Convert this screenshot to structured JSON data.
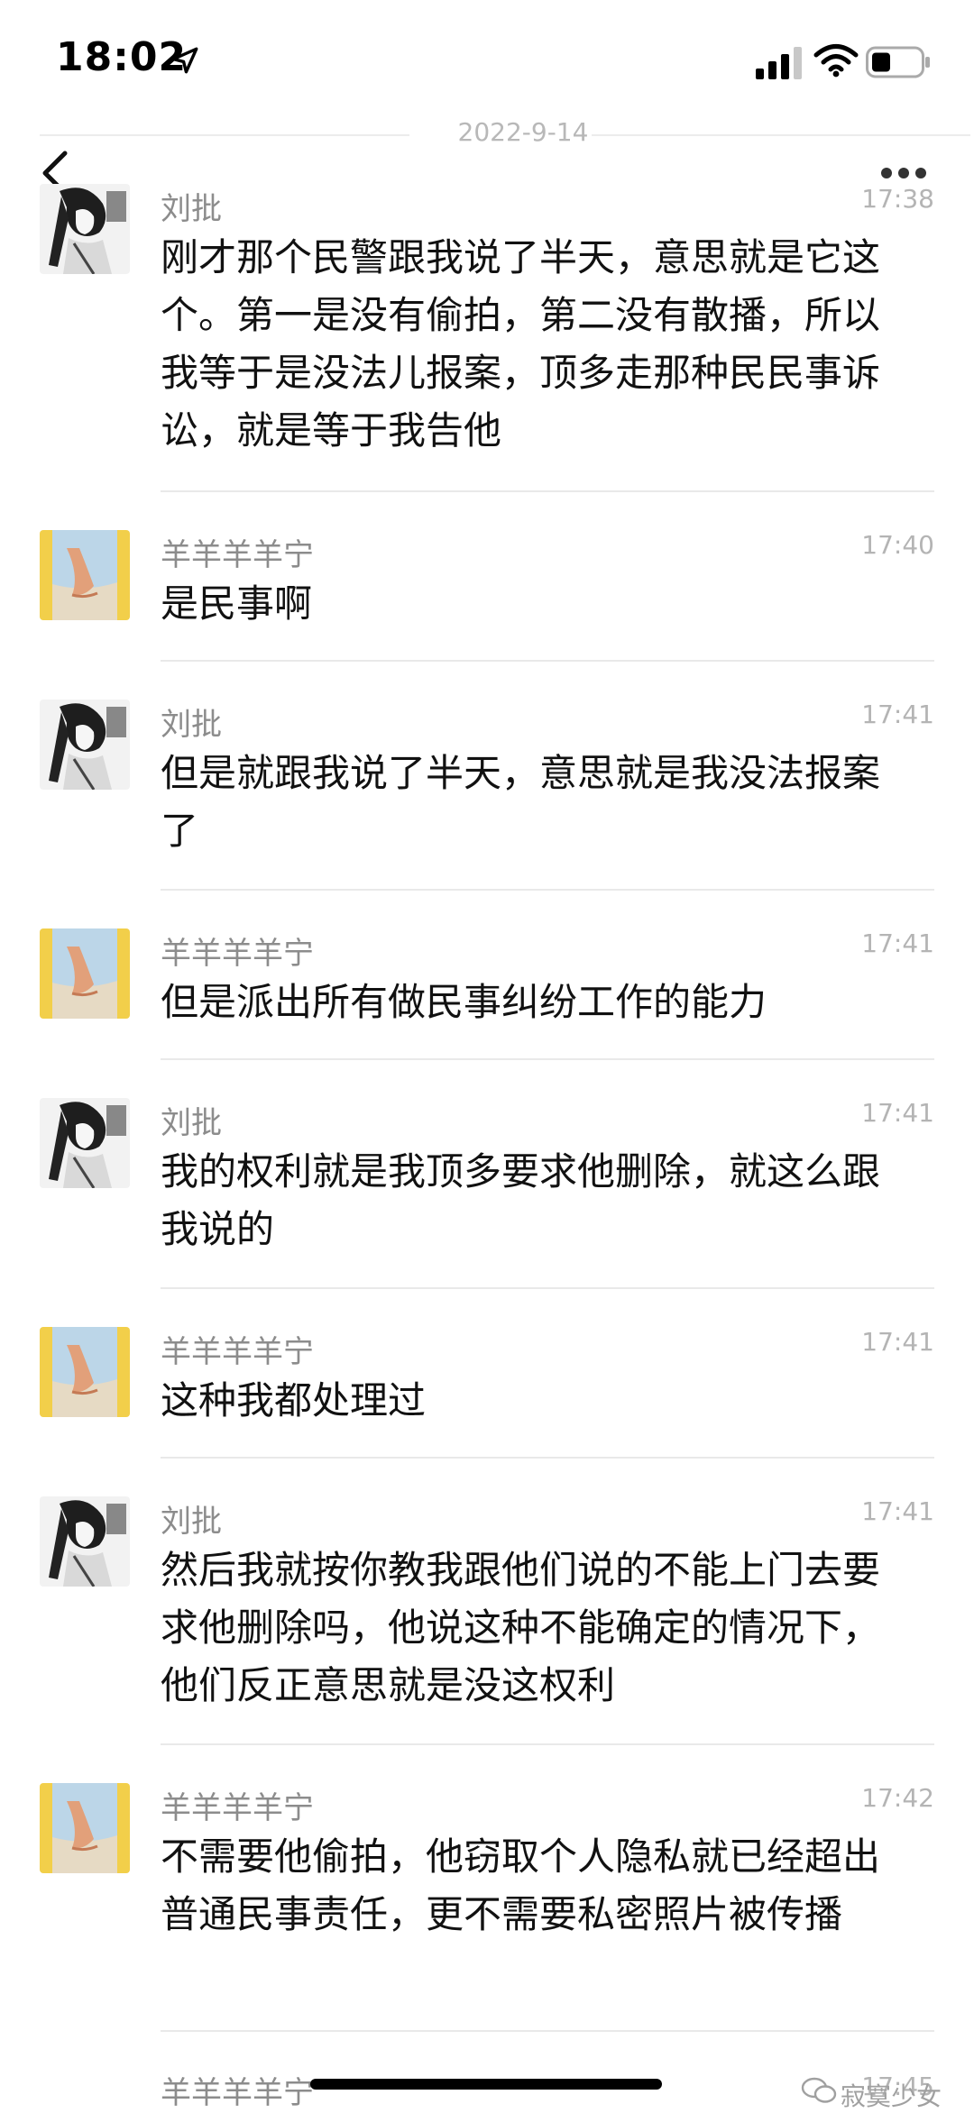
{
  "status_bar": {
    "time": "18:02"
  },
  "date": "2022-9-14",
  "messages": [
    {
      "sender": "刘批",
      "time": "17:38",
      "text": "刚才那个民警跟我说了半天，意思就是它这个。第一是没有偷拍，第二没有散播，所以我等于是没法儿报案，顶多走那种民民事诉讼，就是等于我告他"
    },
    {
      "sender": "羊羊羊羊宁",
      "time": "17:40",
      "text": "是民事啊"
    },
    {
      "sender": "刘批",
      "time": "17:41",
      "text": "但是就跟我说了半天，意思就是我没法报案了"
    },
    {
      "sender": "羊羊羊羊宁",
      "time": "17:41",
      "text": "但是派出所有做民事纠纷工作的能力"
    },
    {
      "sender": "刘批",
      "time": "17:41",
      "text": "我的权利就是我顶多要求他删除，就这么跟我说的"
    },
    {
      "sender": "羊羊羊羊宁",
      "time": "17:41",
      "text": "这种我都处理过"
    },
    {
      "sender": "刘批",
      "time": "17:41",
      "text": "然后我就按你教我跟他们说的不能上门去要求他删除吗，他说这种不能确定的情况下，他们反正意思就是没这权利"
    },
    {
      "sender": "羊羊羊羊宁",
      "time": "17:42",
      "text": "不需要他偷拍，他窃取个人隐私就已经超出普通民事责任，更不需要私密照片被传播"
    },
    {
      "sender": "羊羊羊羊宁",
      "time": "17:45",
      "text": ""
    }
  ],
  "watermark": {
    "text": "寂寞少女"
  },
  "icons": {
    "back": "chevron-left-icon",
    "more": "more-dots-icon",
    "location": "location-arrow-icon",
    "signal": "signal-icon",
    "wifi": "wifi-icon",
    "battery": "battery-icon"
  }
}
